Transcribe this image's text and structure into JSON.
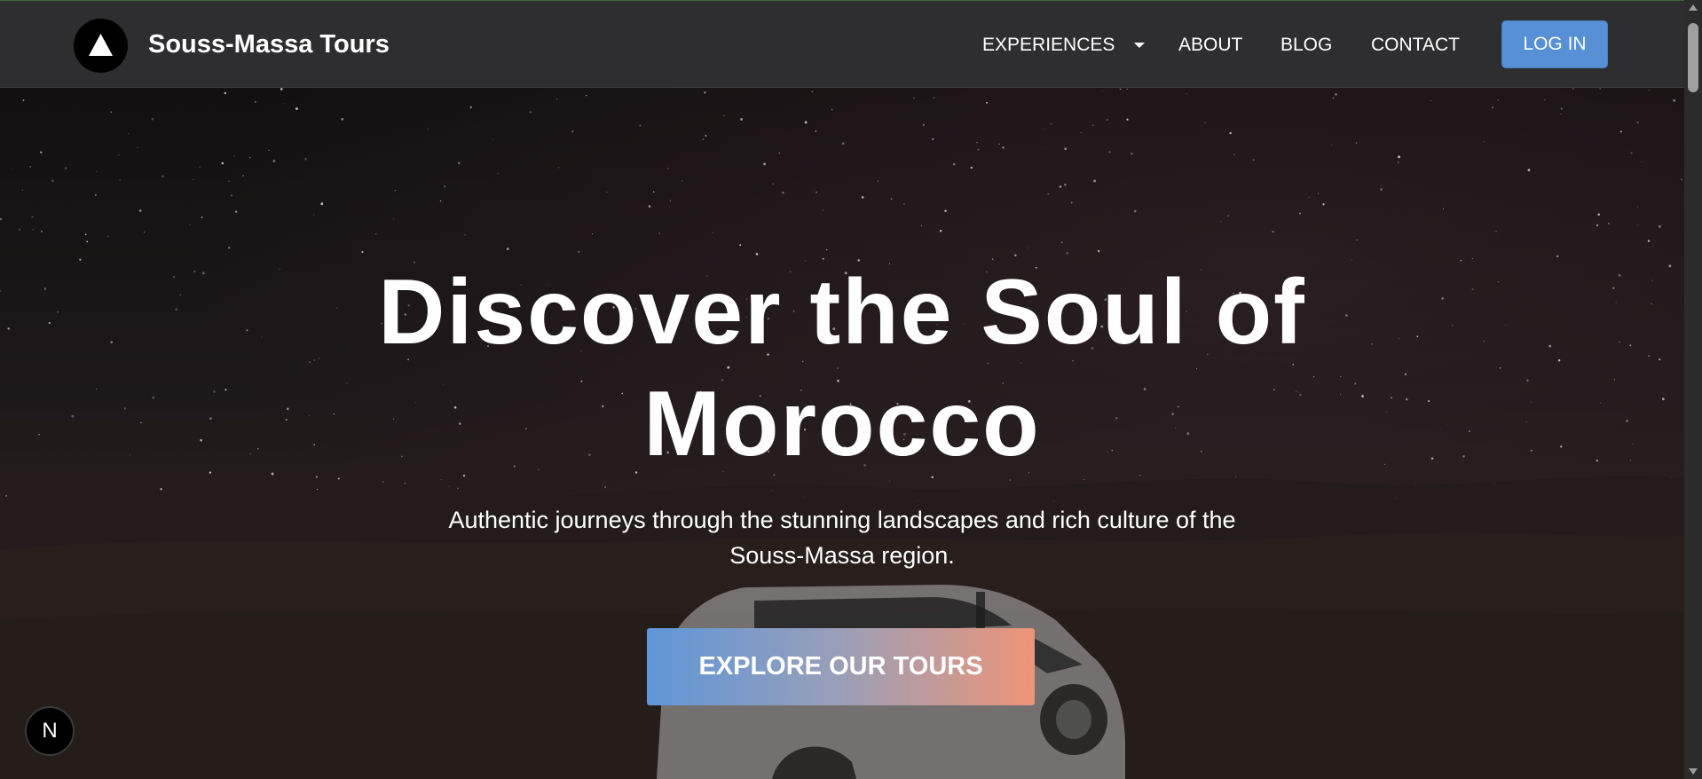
{
  "header": {
    "brand": "Souss-Massa Tours",
    "nav": {
      "experiences": "EXPERIENCES",
      "about": "ABOUT",
      "blog": "BLOG",
      "contact": "CONTACT"
    },
    "login_label": "LOG IN"
  },
  "hero": {
    "title": "Discover the Soul of Morocco",
    "subtitle": "Authentic journeys through the stunning landscapes and rich culture of the Souss-Massa region.",
    "cta_label": "EXPLORE OUR TOURS"
  },
  "dev_badge": {
    "label": "N"
  },
  "colors": {
    "header_bg": "#2e2e30",
    "login_button": "#5790d6",
    "cta_gradient_start": "#5f96d8",
    "cta_gradient_end": "#ee9478",
    "hero_text": "#ffffff"
  },
  "icons": {
    "logo": "triangle-logo-icon",
    "dropdown": "caret-down-icon",
    "vehicle": "suv-image"
  }
}
